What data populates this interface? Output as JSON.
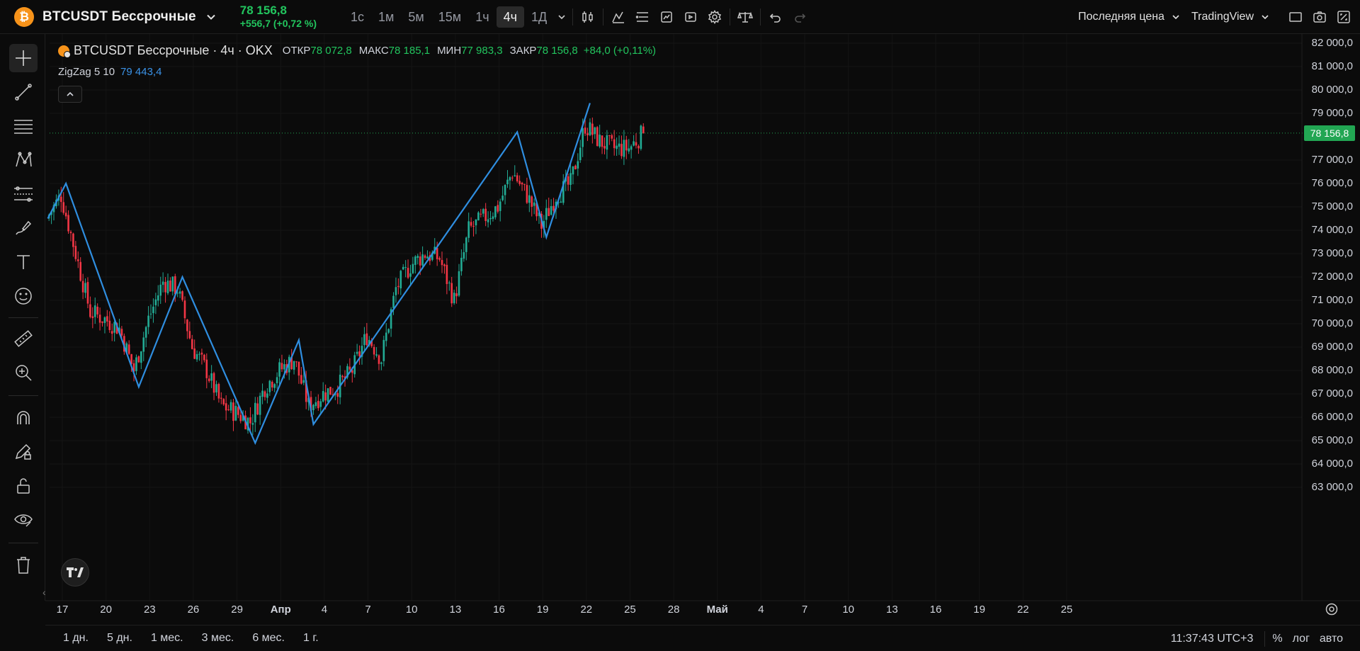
{
  "symbol": {
    "logo_letter": "₿",
    "name": "BTCUSDT Бессрочные",
    "price": "78 156,8",
    "change": "+556,7 (+0,72 %)"
  },
  "intervals": [
    "1с",
    "1м",
    "5м",
    "15м",
    "1ч",
    "4ч",
    "1Д"
  ],
  "active_interval": "4ч",
  "top_right": {
    "price_type": "Последняя цена",
    "source": "TradingView"
  },
  "legend": {
    "title": "BTCUSDT Бессрочные · 4ч · OKX",
    "open_label": "ОТКР",
    "open": "78 072,8",
    "high_label": "МАКС",
    "high": "78 185,1",
    "low_label": "МИН",
    "low": "77 983,3",
    "close_label": "ЗАКР",
    "close": "78 156,8",
    "change": "+84,0 (+0,11%)"
  },
  "indicator": {
    "name": "ZigZag 5 10",
    "value": "79 443,4"
  },
  "price_scale": [
    "82 000,0",
    "81 000,0",
    "80 000,0",
    "79 000,0",
    "77 000,0",
    "76 000,0",
    "75 000,0",
    "74 000,0",
    "73 000,0",
    "72 000,0",
    "71 000,0",
    "70 000,0",
    "69 000,0",
    "68 000,0",
    "67 000,0",
    "66 000,0",
    "65 000,0",
    "64 000,0",
    "63 000,0"
  ],
  "last_price_label": "78 156,8",
  "time_axis": [
    "17",
    "20",
    "23",
    "26",
    "29",
    "Апр",
    "4",
    "7",
    "10",
    "13",
    "16",
    "19",
    "22",
    "25",
    "28",
    "Май",
    "4",
    "7",
    "10",
    "13",
    "16",
    "19",
    "22",
    "25"
  ],
  "bottom": {
    "ranges": [
      "1 дн.",
      "5 дн.",
      "1 мес.",
      "3 мес.",
      "6 мес.",
      "1 г."
    ],
    "clock": "11:37:43 UTC+3",
    "percent": "%",
    "log": "лог",
    "auto": "авто"
  },
  "colors": {
    "up": "#22ab94",
    "down": "#f23645",
    "zigzag": "#2f8ee0",
    "last_price": "#22a653",
    "accent_green": "#22c55e"
  },
  "chart_data": {
    "type": "candlestick",
    "interval": "4h",
    "ylim": [
      63000,
      82000
    ],
    "last_price": 78156.8,
    "zigzag": {
      "name": "ZigZag 5 10",
      "points": [
        {
          "date": "2025-03-17",
          "price": 76000
        },
        {
          "date": "2025-03-22",
          "price": 67300
        },
        {
          "date": "2025-03-25",
          "price": 72000
        },
        {
          "date": "2025-03-30",
          "price": 64900
        },
        {
          "date": "2025-04-02",
          "price": 69300
        },
        {
          "date": "2025-04-03",
          "price": 65700
        },
        {
          "date": "2025-04-17",
          "price": 78200
        },
        {
          "date": "2025-04-19",
          "price": 73700
        },
        {
          "date": "2025-04-22",
          "price": 79440
        }
      ]
    },
    "price_path": [
      [
        "2025-03-16",
        74500
      ],
      [
        "2025-03-17",
        75500
      ],
      [
        "2025-03-18",
        73000
      ],
      [
        "2025-03-19",
        70500
      ],
      [
        "2025-03-20",
        70200
      ],
      [
        "2025-03-21",
        69800
      ],
      [
        "2025-03-22",
        68000
      ],
      [
        "2025-03-23",
        70200
      ],
      [
        "2025-03-24",
        71800
      ],
      [
        "2025-03-25",
        71500
      ],
      [
        "2025-03-26",
        69000
      ],
      [
        "2025-03-27",
        68000
      ],
      [
        "2025-03-28",
        66500
      ],
      [
        "2025-03-29",
        66200
      ],
      [
        "2025-03-30",
        65800
      ],
      [
        "2025-03-31",
        67300
      ],
      [
        "2025-04-01",
        68000
      ],
      [
        "2025-04-02",
        68500
      ],
      [
        "2025-04-03",
        66500
      ],
      [
        "2025-04-04",
        67000
      ],
      [
        "2025-04-05",
        67300
      ],
      [
        "2025-04-06",
        68000
      ],
      [
        "2025-04-07",
        69500
      ],
      [
        "2025-04-08",
        68500
      ],
      [
        "2025-04-09",
        71500
      ],
      [
        "2025-04-10",
        72500
      ],
      [
        "2025-04-11",
        73000
      ],
      [
        "2025-04-12",
        72800
      ],
      [
        "2025-04-13",
        71000
      ],
      [
        "2025-04-14",
        74000
      ],
      [
        "2025-04-15",
        74500
      ],
      [
        "2025-04-16",
        75000
      ],
      [
        "2025-04-17",
        76500
      ],
      [
        "2025-04-18",
        75500
      ],
      [
        "2025-04-19",
        74200
      ],
      [
        "2025-04-20",
        75500
      ],
      [
        "2025-04-21",
        76000
      ],
      [
        "2025-04-22",
        78500
      ],
      [
        "2025-04-23",
        77800
      ],
      [
        "2025-04-24",
        77500
      ],
      [
        "2025-04-25",
        77500
      ],
      [
        "2025-04-26",
        78156.8
      ]
    ]
  }
}
